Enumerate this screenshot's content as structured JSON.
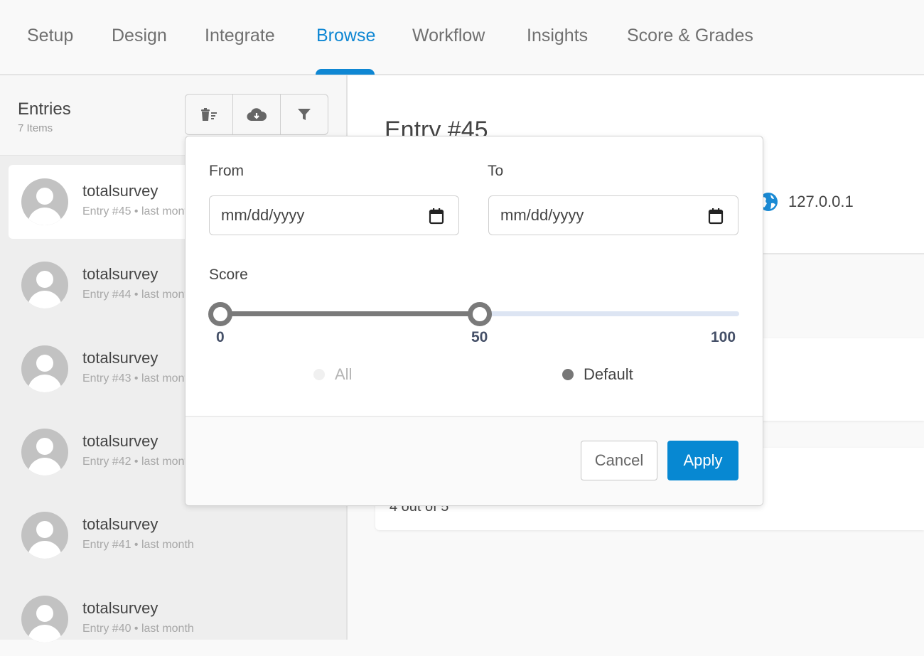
{
  "nav": {
    "tabs": [
      {
        "label": "Setup"
      },
      {
        "label": "Design"
      },
      {
        "label": "Integrate"
      },
      {
        "label": "Browse",
        "active": true
      },
      {
        "label": "Workflow"
      },
      {
        "label": "Insights"
      },
      {
        "label": "Score & Grades"
      }
    ],
    "accent": "#0f87d3"
  },
  "sidebar": {
    "title": "Entries",
    "count": "7 Items",
    "toolbar": [
      {
        "icon": "bulk-delete-icon"
      },
      {
        "icon": "cloud-download-icon"
      },
      {
        "icon": "filter-icon"
      }
    ],
    "entries": [
      {
        "name": "totalsurvey",
        "meta": "Entry #45 • last month",
        "selected": true
      },
      {
        "name": "totalsurvey",
        "meta": "Entry #44 • last month"
      },
      {
        "name": "totalsurvey",
        "meta": "Entry #43 • last month"
      },
      {
        "name": "totalsurvey",
        "meta": "Entry #42 • last month"
      },
      {
        "name": "totalsurvey",
        "meta": "Entry #41 • last month"
      },
      {
        "name": "totalsurvey",
        "meta": "Entry #40 • last month"
      }
    ]
  },
  "main": {
    "entry_title": "Entry #45",
    "ip": "127.0.0.1",
    "score_text": "4 out of 5"
  },
  "filter": {
    "from_label": "From",
    "to_label": "To",
    "from_placeholder": "mm/dd/yyyy",
    "to_placeholder": "mm/dd/yyyy",
    "score_label": "Score",
    "score_min": 0,
    "score_max": 100,
    "score_range": [
      0,
      50
    ],
    "ticks": [
      "0",
      "50",
      "100"
    ],
    "radio": [
      {
        "label": "All",
        "selected": false
      },
      {
        "label": "Default",
        "selected": true
      }
    ],
    "cancel_label": "Cancel",
    "apply_label": "Apply",
    "apply_color": "#0788d2"
  }
}
